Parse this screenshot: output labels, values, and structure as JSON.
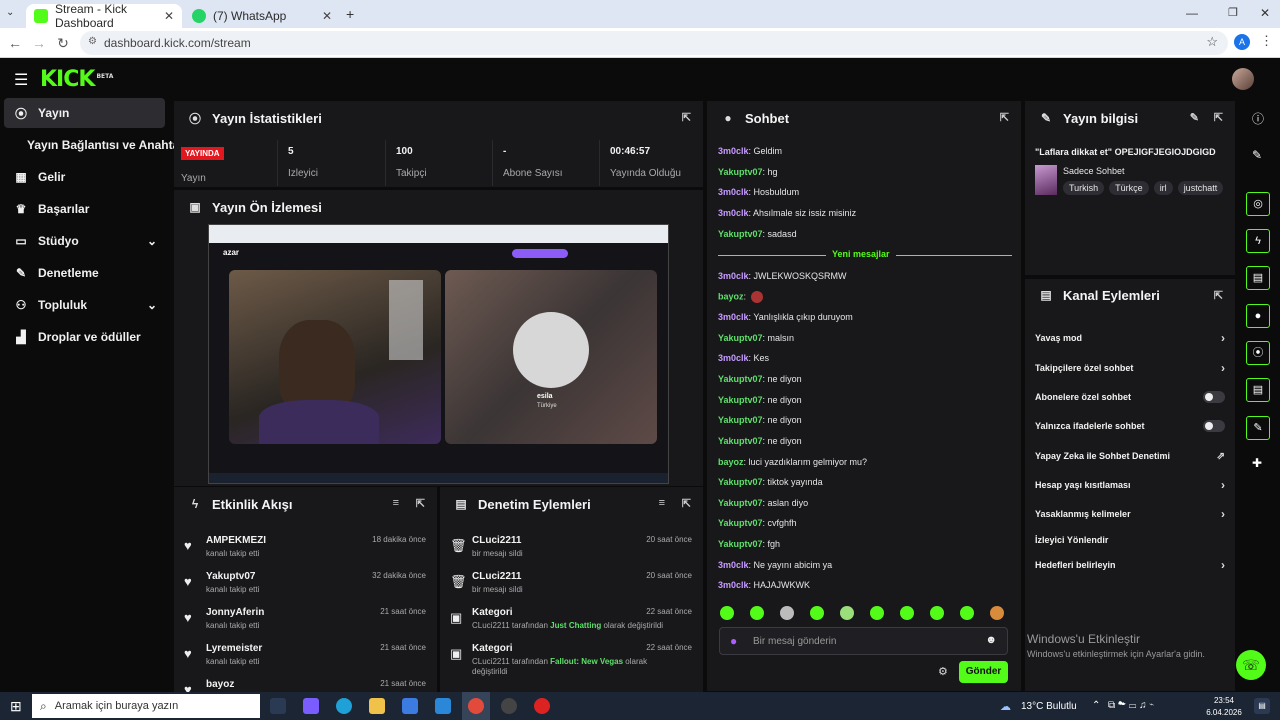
{
  "browser": {
    "tabs": [
      {
        "title": "Stream - Kick Dashboard",
        "active": true
      },
      {
        "title": "(7) WhatsApp",
        "active": false
      }
    ],
    "url": "dashboard.kick.com/stream",
    "profile_letter": "A"
  },
  "app": {
    "logo": "KICK",
    "logo_badge": "BETA"
  },
  "sidebar": {
    "items": [
      {
        "label": "Yayın",
        "icon": "broadcast-icon"
      },
      {
        "label": "Yayın Bağlantısı ve Anahtarı",
        "icon": ""
      },
      {
        "label": "Gelir",
        "icon": "chart-icon"
      },
      {
        "label": "Başarılar",
        "icon": "trophy-icon"
      },
      {
        "label": "Stüdyo",
        "icon": "studio-icon"
      },
      {
        "label": "Denetleme",
        "icon": "wrench-icon"
      },
      {
        "label": "Topluluk",
        "icon": "community-icon"
      },
      {
        "label": "Droplar ve ödüller",
        "icon": "drops-icon"
      }
    ]
  },
  "stats": {
    "title": "Yayın İstatistikleri",
    "live_badge": "YAYINDA",
    "items": [
      {
        "value": "",
        "label": "Yayın"
      },
      {
        "value": "5",
        "label": "İzleyici"
      },
      {
        "value": "100",
        "label": "Takipçi"
      },
      {
        "value": "-",
        "label": "Abone Sayısı"
      },
      {
        "value": "00:46:57",
        "label": "Yayında Olduğu Süre"
      }
    ]
  },
  "preview": {
    "title": "Yayın Ön İzlemesi",
    "peer_name": "esila",
    "peer_country": "Türkiye",
    "app_name": "azar"
  },
  "activity": {
    "title": "Etkinlik Akışı",
    "items": [
      {
        "name": "AMPEKMEZI",
        "sub": "kanalı takip etti",
        "time": "18 dakika önce"
      },
      {
        "name": "Yakuptv07",
        "sub": "kanalı takip etti",
        "time": "32 dakika önce"
      },
      {
        "name": "JonnyAferin",
        "sub": "kanalı takip etti",
        "time": "21 saat önce"
      },
      {
        "name": "Lyremeister",
        "sub": "kanalı takip etti",
        "time": "21 saat önce"
      },
      {
        "name": "bayoz",
        "sub": "",
        "time": "21 saat önce"
      }
    ]
  },
  "moderation": {
    "title": "Denetim Eylemleri",
    "items": [
      {
        "name": "CLuci2211",
        "sub": "bir mesajı sildi",
        "time": "20 saat önce",
        "hl": "",
        "rest": ""
      },
      {
        "name": "CLuci2211",
        "sub": "bir mesajı sildi",
        "time": "20 saat önce",
        "hl": "",
        "rest": ""
      },
      {
        "name": "Kategori",
        "sub": "CLuci2211 tarafından",
        "time": "22 saat önce",
        "hl": "Just Chatting",
        "rest": "olarak değiştirildi"
      },
      {
        "name": "Kategori",
        "sub": "CLuci2211 tarafından",
        "time": "22 saat önce",
        "hl": "Fallout: New Vegas",
        "rest": "olarak değiştirildi"
      }
    ]
  },
  "chat": {
    "title": "Sohbet",
    "new_messages": "Yeni mesajlar",
    "placeholder": "Bir mesaj gönderin",
    "send": "Gönder",
    "messages": [
      {
        "user": "3m0clk",
        "color": "p",
        "text": "Geldim"
      },
      {
        "user": "Yakuptv07",
        "color": "g",
        "text": "hg"
      },
      {
        "user": "3m0clk",
        "color": "p",
        "text": "Hosbuldum"
      },
      {
        "user": "3m0clk",
        "color": "p",
        "text": "Ahsılmale siz issiz misiniz"
      },
      {
        "user": "Yakuptv07",
        "color": "g",
        "text": "sadasd"
      },
      {
        "user": "3m0clk",
        "color": "p",
        "text": "JWLEKWOSKQSRMW"
      },
      {
        "user": "bayoz",
        "color": "g",
        "text": ""
      },
      {
        "user": "3m0clk",
        "color": "p",
        "text": "Yanlışlıkla çıkıp duruyom"
      },
      {
        "user": "Yakuptv07",
        "color": "g",
        "text": "malsın"
      },
      {
        "user": "3m0clk",
        "color": "p",
        "text": "Kes"
      },
      {
        "user": "Yakuptv07",
        "color": "g",
        "text": "ne diyon"
      },
      {
        "user": "Yakuptv07",
        "color": "g",
        "text": "ne diyon"
      },
      {
        "user": "Yakuptv07",
        "color": "g",
        "text": "ne diyon"
      },
      {
        "user": "Yakuptv07",
        "color": "g",
        "text": "ne diyon"
      },
      {
        "user": "bayoz",
        "color": "g",
        "text": "luci yazdıklarım gelmiyor mu?"
      },
      {
        "user": "Yakuptv07",
        "color": "g",
        "text": "tiktok yayında"
      },
      {
        "user": "Yakuptv07",
        "color": "g",
        "text": "aslan diyo"
      },
      {
        "user": "Yakuptv07",
        "color": "g",
        "text": "cvfghfh"
      },
      {
        "user": "Yakuptv07",
        "color": "g",
        "text": "fgh"
      },
      {
        "user": "3m0clk",
        "color": "p",
        "text": "Ne yayını abicim ya"
      },
      {
        "user": "3m0clk",
        "color": "p",
        "text": "HAJAJWKWK"
      }
    ]
  },
  "info": {
    "title": "Yayın bilgisi",
    "stream_title": "\"Laflara dikkat et\" OPEJIGFJEGIOJDGIGD",
    "category": "Sadece Sohbet",
    "tags": [
      "Turkish",
      "Türkçe",
      "irl",
      "justchatt"
    ]
  },
  "channel": {
    "title": "Kanal Eylemleri",
    "items": [
      {
        "label": "Yavaş mod",
        "ctrl": "arrow"
      },
      {
        "label": "Takipçilere özel sohbet",
        "ctrl": "arrow"
      },
      {
        "label": "Abonelere özel sohbet",
        "ctrl": "toggle"
      },
      {
        "label": "Yalnızca ifadelerle sohbet",
        "ctrl": "toggle"
      },
      {
        "label": "Yapay Zeka ile Sohbet Denetimi",
        "ctrl": "ext"
      },
      {
        "label": "Hesap yaşı kısıtlaması",
        "ctrl": "arrow"
      },
      {
        "label": "Yasaklanmış kelimeler",
        "ctrl": "arrow"
      },
      {
        "label": "İzleyici Yönlendir",
        "ctrl": ""
      },
      {
        "label": "Hedefleri belirleyin",
        "ctrl": "arrow"
      }
    ]
  },
  "watermark": {
    "line1": "Windows'u Etkinleştir",
    "line2": "Windows'u etkinleştirmek için Ayarlar'a gidin."
  },
  "taskbar": {
    "search": "Aramak için buraya yazın",
    "weather": "13°C Bulutlu",
    "time": "23:54",
    "date": "6.04.2026"
  }
}
